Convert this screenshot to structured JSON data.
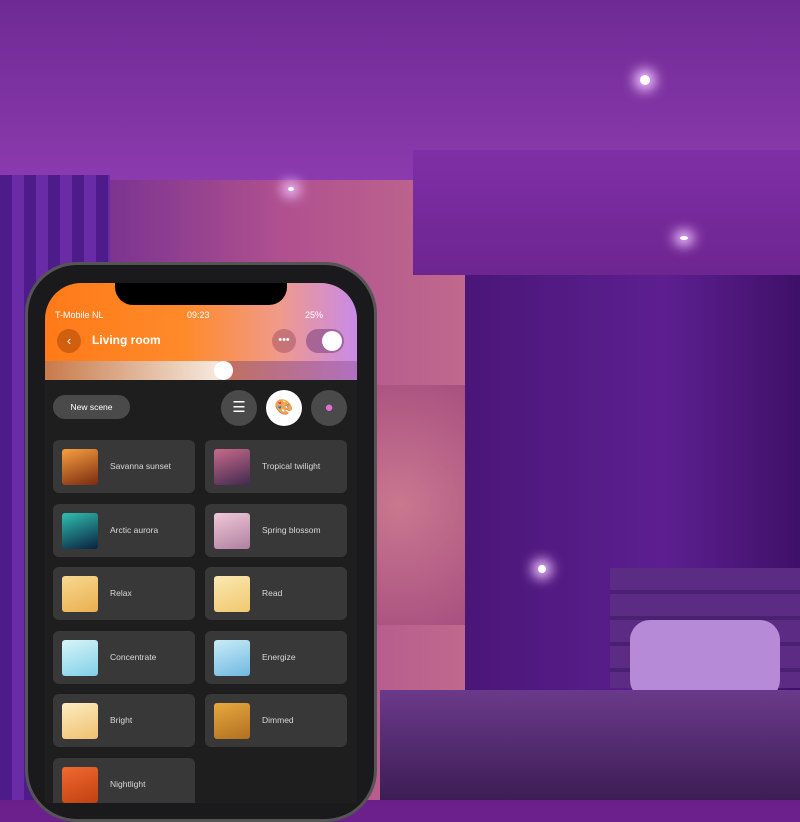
{
  "status_bar": {
    "carrier": "T-Mobile NL",
    "time": "09:23",
    "battery": "25%"
  },
  "header": {
    "title": "Living room",
    "back_icon": "chevron-left-icon",
    "more_icon": "ellipsis-icon",
    "power_on": true,
    "brightness_percent": 57
  },
  "toolbar": {
    "new_scene_label": "New scene",
    "views": [
      {
        "icon": "list-icon",
        "active": false
      },
      {
        "icon": "palette-icon",
        "active": true
      },
      {
        "icon": "color-picker-icon",
        "active": false
      }
    ]
  },
  "scenes": [
    {
      "label": "Savanna sunset",
      "colors": [
        "#f7a040",
        "#7a2a10"
      ]
    },
    {
      "label": "Tropical twilight",
      "colors": [
        "#c86a8a",
        "#402a50"
      ]
    },
    {
      "label": "Arctic aurora",
      "colors": [
        "#30c0b0",
        "#0a2040"
      ]
    },
    {
      "label": "Spring blossom",
      "colors": [
        "#f0c8d8",
        "#b080a0"
      ]
    },
    {
      "label": "Relax",
      "colors": [
        "#f8d890",
        "#e8b050"
      ]
    },
    {
      "label": "Read",
      "colors": [
        "#fbe8b0",
        "#f0c870"
      ]
    },
    {
      "label": "Concentrate",
      "colors": [
        "#d8f4f8",
        "#80d0e8"
      ]
    },
    {
      "label": "Energize",
      "colors": [
        "#c8ecf8",
        "#70b8e0"
      ]
    },
    {
      "label": "Bright",
      "colors": [
        "#fcecc0",
        "#f0c070"
      ]
    },
    {
      "label": "Dimmed",
      "colors": [
        "#e8a840",
        "#b07020"
      ]
    },
    {
      "label": "Nightlight",
      "colors": [
        "#f06a30",
        "#c04010"
      ]
    }
  ]
}
